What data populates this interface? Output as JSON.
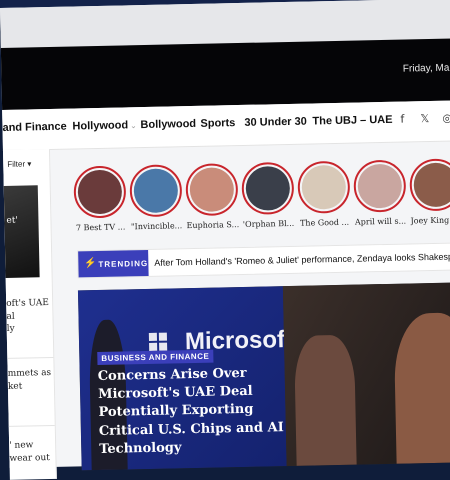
{
  "header": {
    "date": "Friday, Ma"
  },
  "nav": {
    "items": [
      {
        "label": "and Finance"
      },
      {
        "label": "Hollywood"
      },
      {
        "label": "Bollywood"
      },
      {
        "label": "Sports"
      },
      {
        "label": "30 Under 30"
      },
      {
        "label": "The UBJ – UAE"
      }
    ],
    "social": [
      "facebook-icon",
      "x-icon",
      "instagram-icon"
    ],
    "social_glyphs": {
      "facebook": "f",
      "x": "𝕏",
      "instagram": "◎"
    }
  },
  "sidebar": {
    "filter_label": "Filter",
    "image_caption": "et'",
    "items": [
      "oft's UAE\nal\nly",
      "mmets as\nket",
      "' new\nwear out"
    ]
  },
  "stories": [
    {
      "label": "7 Best TV ...",
      "color": "#6a3b3b"
    },
    {
      "label": "\"Invincible...",
      "color": "#4a78a8"
    },
    {
      "label": "Euphoria S...",
      "color": "#c98c7a"
    },
    {
      "label": "'Orphan Bl...",
      "color": "#3a3f4a"
    },
    {
      "label": "The Good ...",
      "color": "#d8c9b8"
    },
    {
      "label": "April will s...",
      "color": "#c9a6a0"
    },
    {
      "label": "Joey King s...",
      "color": "#8b5c4a"
    }
  ],
  "trending": {
    "badge": "TRENDING",
    "text": "After Tom Holland's 'Romeo & Juliet' performance, Zendaya looks Shakespearean in"
  },
  "hero": {
    "category": "BUSINESS AND FINANCE",
    "headline": "Concerns Arise Over Microsoft's UAE Deal Potentially Exporting Critical U.S. Chips and AI Technology",
    "brand_text": "Microsoft"
  },
  "colors": {
    "accent": "#3b3fba",
    "story_ring": "#c8252c",
    "topbar": "#050507"
  }
}
